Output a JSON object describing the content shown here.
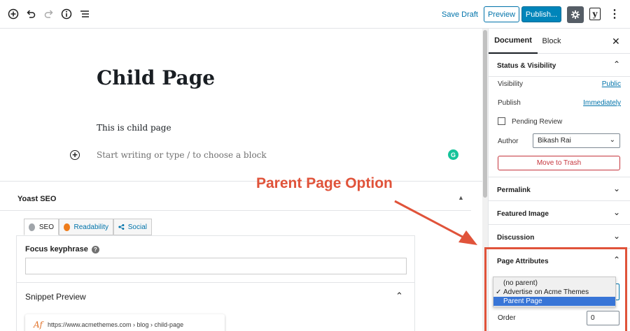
{
  "toolbar": {
    "icons": [
      "add-block-icon",
      "undo-icon",
      "redo-icon",
      "info-icon",
      "list-view-icon"
    ],
    "save_draft": "Save Draft",
    "preview": "Preview",
    "publish": "Publish...",
    "yoast_letter": "y",
    "more": "⋮"
  },
  "editor": {
    "title": "Child Page",
    "paragraph": "This is child page",
    "placeholder": "Start writing or type / to choose a block",
    "grammarly": "G"
  },
  "yoast": {
    "title": "Yoast SEO",
    "tabs": [
      {
        "label": "SEO",
        "color": "#a0a5aa"
      },
      {
        "label": "Readability",
        "color": "#ee7c1b"
      },
      {
        "label": "Social",
        "color": "#0073aa"
      }
    ],
    "focus_keyphrase_label": "Focus keyphrase",
    "focus_keyphrase_value": "",
    "snippet_preview": "Snippet Preview",
    "snippet_url": "https://www.acmethemes.com › blog › child-page"
  },
  "annotation": {
    "text": "Parent Page Option",
    "color": "#e0533a"
  },
  "sidebar": {
    "tab_document": "Document",
    "tab_block": "Block",
    "status_visibility": {
      "title": "Status & Visibility",
      "visibility_label": "Visibility",
      "visibility_value": "Public",
      "publish_label": "Publish",
      "publish_value": "Immediately",
      "pending_review": "Pending Review",
      "pending_checked": false,
      "author_label": "Author",
      "author_value": "Bikash Rai",
      "trash": "Move to Trash"
    },
    "permalink": "Permalink",
    "featured_image": "Featured Image",
    "discussion": "Discussion",
    "page_attributes": {
      "title": "Page Attributes",
      "options": [
        "(no parent)",
        "Advertise on Acme Themes",
        "Parent Page"
      ],
      "checked_option": "Advertise on Acme Themes",
      "highlighted_option": "Parent Page",
      "order_label": "Order",
      "order_value": "0"
    }
  }
}
